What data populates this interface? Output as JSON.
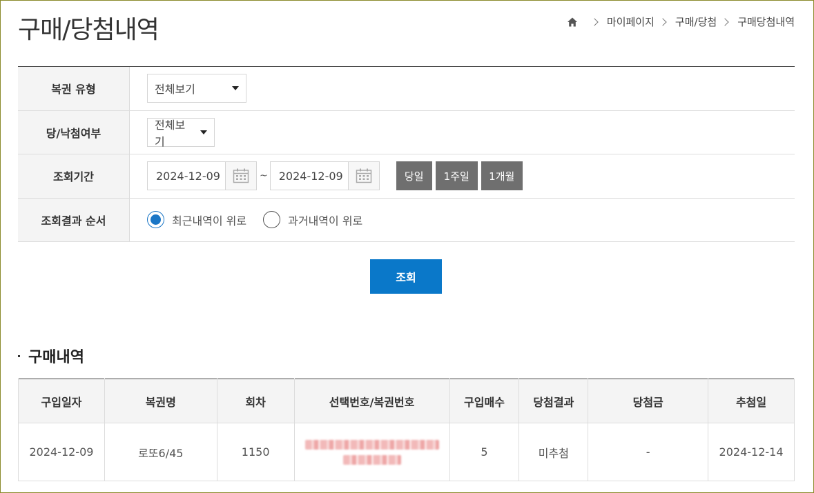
{
  "page": {
    "title": "구매/당첨내역"
  },
  "breadcrumb": {
    "items": [
      "마이페이지",
      "구매/당첨",
      "구매당첨내역"
    ]
  },
  "search": {
    "lottery_type": {
      "label": "복권 유형",
      "value": "전체보기"
    },
    "win_status": {
      "label": "당/낙첨여부",
      "value": "전체보기"
    },
    "period": {
      "label": "조회기간",
      "start_date": "2024-12-09",
      "separator": "~",
      "end_date": "2024-12-09",
      "buttons": [
        "당일",
        "1주일",
        "1개월"
      ]
    },
    "order": {
      "label": "조회결과 순서",
      "options": [
        "최근내역이 위로",
        "과거내역이 위로"
      ],
      "selected": "최근내역이 위로"
    },
    "submit_label": "조회"
  },
  "purchases": {
    "title": "구매내역",
    "columns": [
      "구입일자",
      "복권명",
      "회차",
      "선택번호/복권번호",
      "구입매수",
      "당첨결과",
      "당첨금",
      "추첨일"
    ],
    "rows": [
      {
        "purchase_date": "2024-12-09",
        "lottery_name": "로또6/45",
        "round": "1150",
        "quantity": "5",
        "result": "미추첨",
        "prize": "-",
        "draw_date": "2024-12-14"
      }
    ]
  },
  "colors": {
    "primary_button": "#0a78c9",
    "period_button": "#6f6f6f",
    "radio_selected": "#1a76c6"
  },
  "icons": [
    "home-icon",
    "chevron-right-icon",
    "calendar-icon",
    "caret-down-icon"
  ]
}
